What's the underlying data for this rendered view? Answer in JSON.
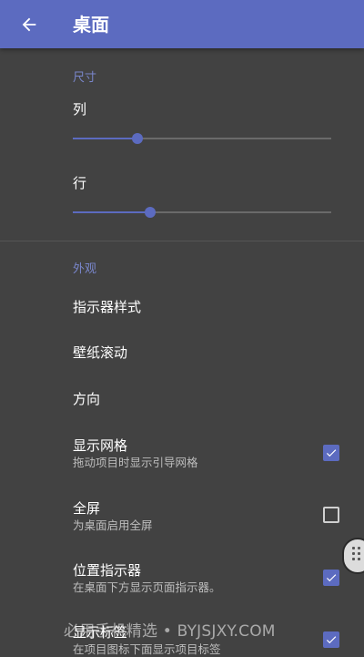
{
  "appbar": {
    "title": "桌面",
    "back_icon": "arrow-left-icon",
    "background": "#5c6bc0"
  },
  "sections": {
    "size_header": "尺寸",
    "look_header": "外观"
  },
  "sliders": {
    "columns": {
      "label": "列",
      "value_fraction": 0.25
    },
    "rows": {
      "label": "行",
      "value_fraction": 0.3
    }
  },
  "prefs": {
    "indicator_style": {
      "title": "指示器样式"
    },
    "wallpaper_scroll": {
      "title": "壁纸滚动"
    },
    "orientation": {
      "title": "方向"
    },
    "show_grid": {
      "title": "显示网格",
      "summary": "拖动项目时显示引导网格",
      "checked": true
    },
    "fullscreen": {
      "title": "全屏",
      "summary": "为桌面启用全屏",
      "checked": false
    },
    "page_indicator": {
      "title": "位置指示器",
      "summary": "在桌面下方显示页面指示器。",
      "checked": true
    },
    "show_labels": {
      "title": "显示标签",
      "summary": "在项目图标下面显示项目标签",
      "checked": true
    }
  },
  "watermark": "必用手机精选 • BYJSJXY.COM",
  "colors": {
    "accent": "#5c6bc0",
    "header_text": "#7986cb",
    "background": "#424242"
  }
}
